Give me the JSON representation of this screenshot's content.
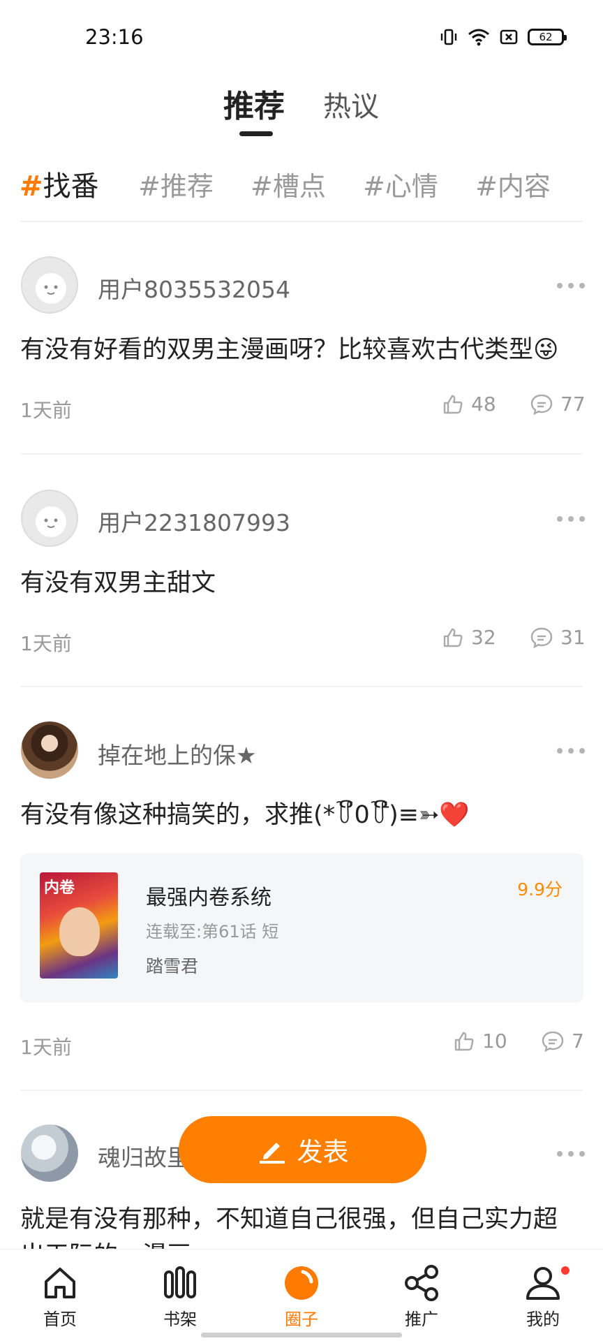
{
  "status_bar": {
    "time": "23:16",
    "battery": "62"
  },
  "top_tabs": [
    {
      "label": "推荐",
      "active": true
    },
    {
      "label": "热议",
      "active": false
    }
  ],
  "tags": [
    {
      "text": "找番",
      "active": true
    },
    {
      "text": "推荐",
      "active": false
    },
    {
      "text": "槽点",
      "active": false
    },
    {
      "text": "心情",
      "active": false
    },
    {
      "text": "内容",
      "active": false
    }
  ],
  "posts": [
    {
      "username": "用户8035532054",
      "content": "有没有好看的双男主漫画呀？比较喜欢古代类型😜",
      "time": "1天前",
      "likes": "48",
      "comments": "77"
    },
    {
      "username": "用户2231807993",
      "content": "有没有双男主甜文",
      "time": "1天前",
      "likes": "32",
      "comments": "31"
    },
    {
      "username": "掉在地上的保★",
      "content": "有没有像这种搞笑的，求推(*꒦ິ0꒦ີ)≡➳❤️",
      "time": "1天前",
      "likes": "10",
      "comments": "7",
      "book": {
        "title": "最强内卷系统",
        "score": "9.9分",
        "progress": "连载至:第61话 短",
        "author": "踏雪君",
        "cover_text": "内卷"
      }
    },
    {
      "username": "魂归故里",
      "content": "就是有没有那种，不知道自己很强，但自己实力超",
      "content_line2": "出天际的，漫画"
    }
  ],
  "fab": {
    "label": "发表"
  },
  "bottom_nav": [
    {
      "label": "首页",
      "icon": "home-icon"
    },
    {
      "label": "书架",
      "icon": "bookshelf-icon"
    },
    {
      "label": "圈子",
      "icon": "circle-icon",
      "active": true
    },
    {
      "label": "推广",
      "icon": "share-icon"
    },
    {
      "label": "我的",
      "icon": "profile-icon"
    }
  ],
  "colors": {
    "accent": "#ff7a00",
    "fab": "#ff8000",
    "notification_dot": "#ff3b30"
  }
}
